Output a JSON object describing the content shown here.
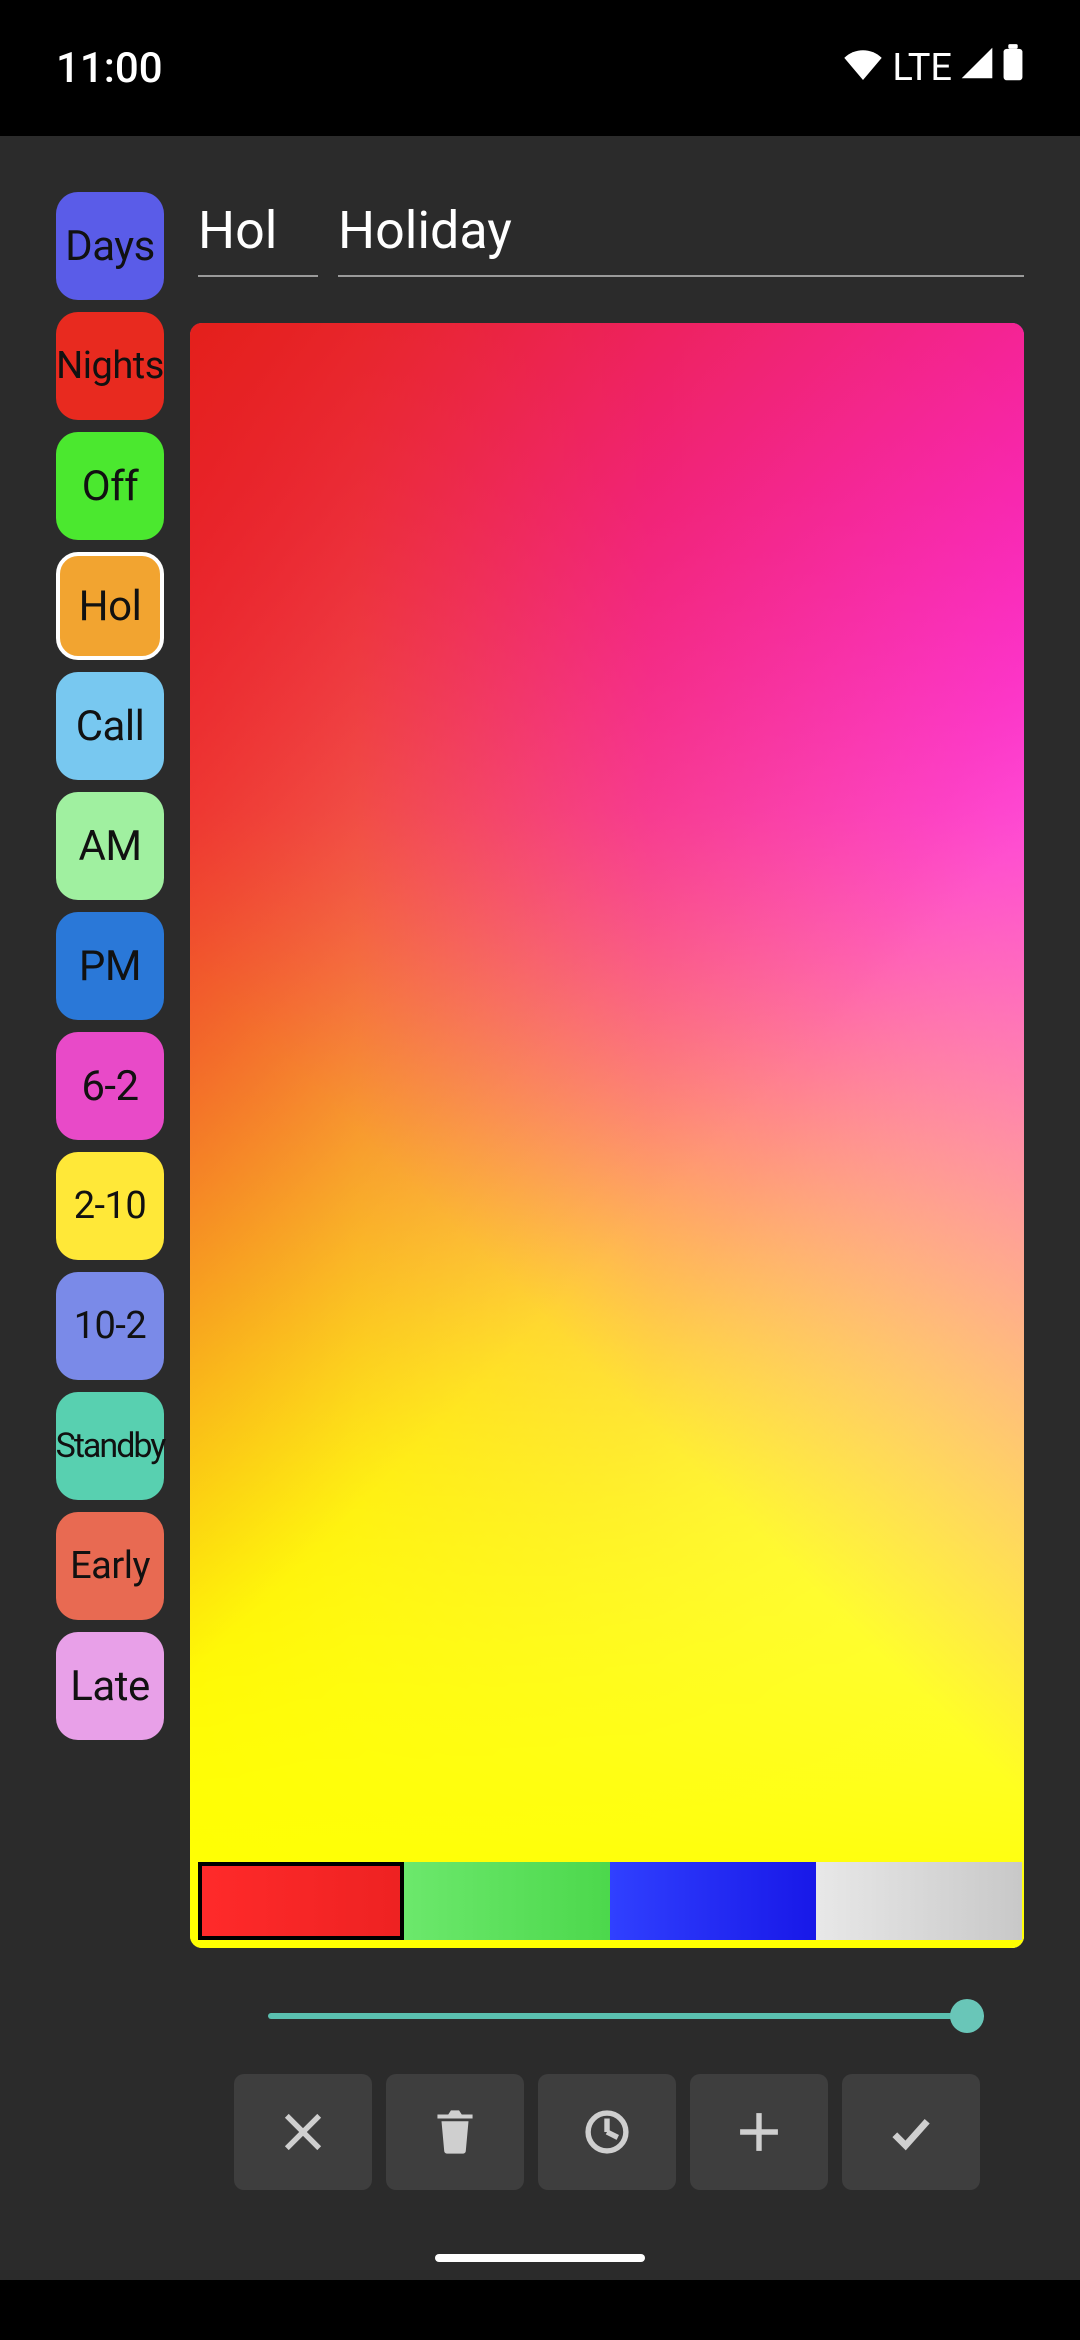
{
  "status": {
    "time": "11:00",
    "network": "LTE"
  },
  "inputs": {
    "short": "Hol",
    "long": "Holiday"
  },
  "tags": [
    {
      "label": "Days",
      "bg": "#5a5ce8",
      "fg": "#111",
      "size": "",
      "selected": false
    },
    {
      "label": "Nights",
      "bg": "#e82a1f",
      "fg": "#111",
      "size": "small",
      "selected": false
    },
    {
      "label": "Off",
      "bg": "#4be82f",
      "fg": "#111",
      "size": "",
      "selected": false
    },
    {
      "label": "Hol",
      "bg": "#f2a430",
      "fg": "#111",
      "size": "",
      "selected": true
    },
    {
      "label": "Call",
      "bg": "#78c8f0",
      "fg": "#111",
      "size": "",
      "selected": false
    },
    {
      "label": "AM",
      "bg": "#a0f0a0",
      "fg": "#111",
      "size": "",
      "selected": false
    },
    {
      "label": "PM",
      "bg": "#2a78d8",
      "fg": "#111",
      "size": "",
      "selected": false
    },
    {
      "label": "6-2",
      "bg": "#e84ac8",
      "fg": "#111",
      "size": "",
      "selected": false
    },
    {
      "label": "2-10",
      "bg": "#ffe838",
      "fg": "#111",
      "size": "small",
      "selected": false
    },
    {
      "label": "10-2",
      "bg": "#7a8ae8",
      "fg": "#111",
      "size": "small",
      "selected": false
    },
    {
      "label": "Standby",
      "bg": "#58d0b0",
      "fg": "#111",
      "size": "tiny",
      "selected": false
    },
    {
      "label": "Early",
      "bg": "#e86a52",
      "fg": "#111",
      "size": "small",
      "selected": false
    },
    {
      "label": "Late",
      "bg": "#e8a0e8",
      "fg": "#111",
      "size": "",
      "selected": false
    }
  ],
  "swatches": [
    {
      "name": "red",
      "active": true
    },
    {
      "name": "green",
      "active": false
    },
    {
      "name": "blue",
      "active": false
    },
    {
      "name": "gray",
      "active": false
    }
  ],
  "slider": {
    "value": 100,
    "min": 0,
    "max": 100
  },
  "actions": {
    "cancel": "cancel",
    "delete": "delete",
    "time": "time",
    "add": "add",
    "confirm": "confirm"
  }
}
